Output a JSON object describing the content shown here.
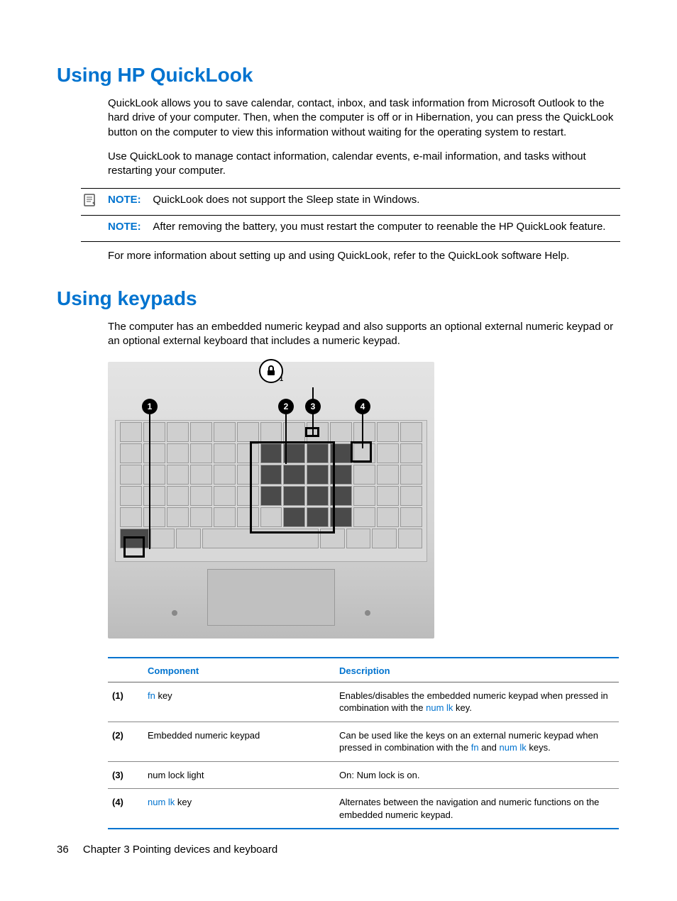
{
  "section1": {
    "heading": "Using HP QuickLook",
    "p1": "QuickLook allows you to save calendar, contact, inbox, and task information from Microsoft Outlook to the hard drive of your computer. Then, when the computer is off or in Hibernation, you can press the QuickLook button on the computer to view this information without waiting for the operating system to restart.",
    "p2": "Use QuickLook to manage contact information, calendar events, e-mail information, and tasks without restarting your computer.",
    "note_label": "NOTE:",
    "note1": "QuickLook does not support the Sleep state in Windows.",
    "note2": "After removing the battery, you must restart the computer to reenable the HP QuickLook feature.",
    "p3": "For more information about setting up and using QuickLook, refer to the QuickLook software Help."
  },
  "section2": {
    "heading": "Using keypads",
    "p1": "The computer has an embedded numeric keypad and also supports an optional external numeric keypad or an optional external keyboard that includes a numeric keypad."
  },
  "callouts": {
    "c1": "1",
    "c2": "2",
    "c3": "3",
    "c4": "4"
  },
  "table": {
    "headers": {
      "component": "Component",
      "description": "Description"
    },
    "rows": [
      {
        "idx": "(1)",
        "component_parts": [
          {
            "t": "fn",
            "link": true
          },
          {
            "t": " key",
            "link": false
          }
        ],
        "description_parts": [
          {
            "t": "Enables/disables the embedded numeric keypad when pressed in combination with the ",
            "link": false
          },
          {
            "t": "num lk",
            "link": true
          },
          {
            "t": " key.",
            "link": false
          }
        ]
      },
      {
        "idx": "(2)",
        "component_parts": [
          {
            "t": "Embedded numeric keypad",
            "link": false
          }
        ],
        "description_parts": [
          {
            "t": "Can be used like the keys on an external numeric keypad when pressed in combination with the ",
            "link": false
          },
          {
            "t": "fn",
            "link": true
          },
          {
            "t": " and ",
            "link": false
          },
          {
            "t": "num lk",
            "link": true
          },
          {
            "t": " keys.",
            "link": false
          }
        ]
      },
      {
        "idx": "(3)",
        "component_parts": [
          {
            "t": "num lock light",
            "link": false
          }
        ],
        "description_parts": [
          {
            "t": "On: Num lock is on.",
            "link": false
          }
        ]
      },
      {
        "idx": "(4)",
        "component_parts": [
          {
            "t": "num lk",
            "link": true
          },
          {
            "t": " key",
            "link": false
          }
        ],
        "description_parts": [
          {
            "t": "Alternates between the navigation and numeric functions on the embedded numeric keypad.",
            "link": false
          }
        ]
      }
    ]
  },
  "footer": {
    "page": "36",
    "chapter": "Chapter 3   Pointing devices and keyboard"
  }
}
